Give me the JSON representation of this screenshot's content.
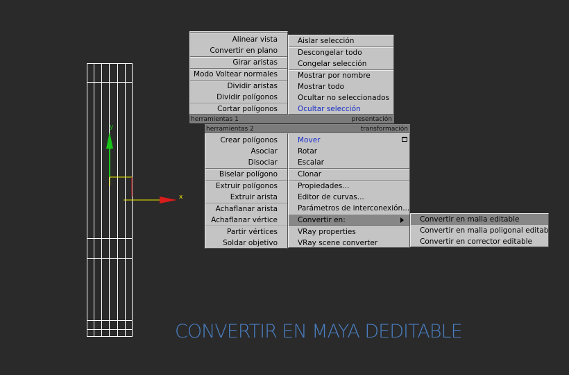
{
  "viewport": {
    "axis_x_label": "x",
    "axis_y_label": "y"
  },
  "menu_herramientas1": [
    "Alinear vista",
    "Convertir en plano",
    "Girar aristas",
    "Modo Voltear normales",
    "Dividir aristas",
    "Dividir polígonos",
    "Cortar polígonos"
  ],
  "menu_presentacion": [
    "Aislar selección",
    "Descongelar todo",
    "Congelar selección",
    "Mostrar por nombre",
    "Mostrar todo",
    "Ocultar no seleccionados",
    "Ocultar selección"
  ],
  "bars": {
    "herramientas1": "herramientas 1",
    "presentacion": "presentación",
    "herramientas2": "herramientas 2",
    "transformacion": "transformación"
  },
  "menu_herramientas2": [
    "Crear polígonos",
    "Asociar",
    "Disociar",
    "Biselar polígono",
    "Extruir polígonos",
    "Extruir arista",
    "Achaflanar arista",
    "Achaflanar vértice",
    "Partir vértices",
    "Soldar objetivo"
  ],
  "menu_transformacion": [
    "Mover",
    "Rotar",
    "Escalar",
    "Clonar",
    "Propiedades...",
    "Editor de curvas...",
    "Parámetros de interconexión...",
    "Convertir en:",
    "VRay properties",
    "VRay scene converter"
  ],
  "submenu_convertir": [
    "Convertir en malla editable",
    "Convertir en malla poligonal editable",
    "Convertir en corrector editable"
  ],
  "caption": "CONVERTIR EN MAYA DEDITABLE",
  "colors": {
    "background": "#2a2a2a",
    "menu": "#c4c4c4",
    "highlight_text": "#1a2fc8",
    "selected": "#878787",
    "caption": "#4a7fc1"
  }
}
